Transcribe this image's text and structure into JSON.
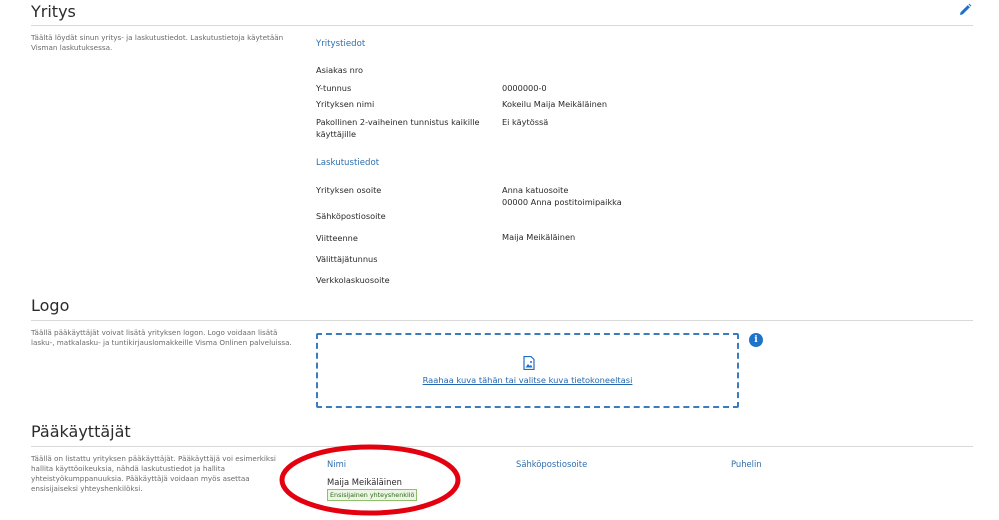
{
  "company": {
    "title": "Yritys",
    "description": "Täältä löydät sinun yritys- ja laskutustiedot. Laskutustietoja käytetään Visman laskutuksessa.",
    "company_info_heading": "Yritystiedot",
    "fields": [
      {
        "label": "Asiakas nro",
        "value": ""
      },
      {
        "label": "Y-tunnus",
        "value": "0000000-0"
      },
      {
        "label": "Yrityksen nimi",
        "value": "Kokeilu Maija Meikäläinen"
      },
      {
        "label": "Pakollinen 2-vaiheinen tunnistus kaikille käyttäjille",
        "value": "Ei käytössä"
      }
    ],
    "billing_heading": "Laskutustiedot",
    "billing_fields": [
      {
        "label": "Yrityksen osoite",
        "value_line1": "Anna katuosoite",
        "value_line2": "00000 Anna postitoimipaikka"
      },
      {
        "label": "Sähköpostiosoite",
        "value": ""
      },
      {
        "label": "Viitteenne",
        "value": "Maija Meikäläinen"
      },
      {
        "label": "Välittäjätunnus",
        "value": ""
      },
      {
        "label": "Verkkolaskuosoite",
        "value": ""
      }
    ],
    "edit_icon": "pencil-icon"
  },
  "logo": {
    "title": "Logo",
    "description": "Täällä pääkäyttäjät voivat lisätä yrityksen logon. Logo voidaan lisätä lasku-, matkalasku- ja tuntikirjauslomakkeille Visma Onlinen palveluissa.",
    "dropzone_text": "Raahaa kuva tähän tai valitse kuva tietokoneeltasi",
    "dropzone_icon": "image-file-icon",
    "info_icon": "info-icon",
    "info_glyph": "i"
  },
  "admins": {
    "title": "Pääkäyttäjät",
    "description": "Täällä on listattu yrityksen pääkäyttäjät. Pääkäyttäjä voi esimerkiksi hallita käyttöoikeuksia, nähdä laskutustiedot ja hallita yhteistyökumppanuuksia. Pääkäyttäjä voidaan myös asettaa ensisijaiseksi yhteyshenkilöksi.",
    "columns": {
      "name": "Nimi",
      "email": "Sähköpostiosoite",
      "phone": "Puhelin"
    },
    "rows": [
      {
        "name": "Maija Meikäläinen",
        "badge": "Ensisijainen yhteyshenkilö",
        "email": "",
        "phone": ""
      }
    ]
  },
  "colors": {
    "accent": "#2f6fad",
    "link": "#2367b1",
    "annotation": "#e3000f",
    "badge_border": "#8fbf6a"
  }
}
